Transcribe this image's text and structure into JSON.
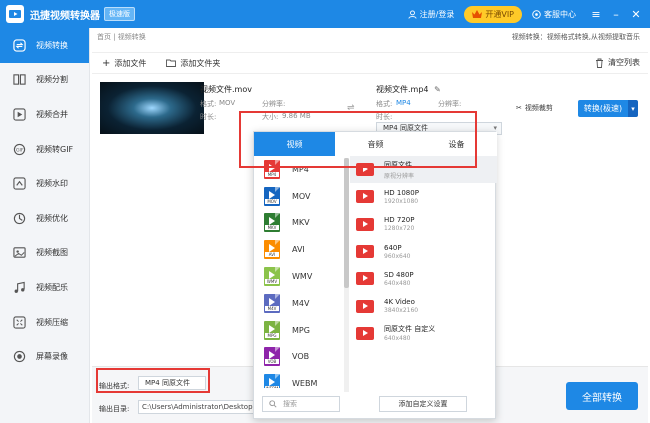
{
  "titlebar": {
    "title": "迅捷视频转换器",
    "badge": "极速版",
    "login": "注册/登录",
    "vip": "开通VIP",
    "service": "客服中心"
  },
  "sidebar": {
    "items": [
      {
        "label": "视频转换",
        "icon": "convert-icon",
        "active": true
      },
      {
        "label": "视频分割",
        "icon": "split-icon"
      },
      {
        "label": "视频合并",
        "icon": "merge-icon"
      },
      {
        "label": "视频转GIF",
        "icon": "gif-icon"
      },
      {
        "label": "视频水印",
        "icon": "watermark-icon"
      },
      {
        "label": "视频优化",
        "icon": "optimize-icon"
      },
      {
        "label": "视频截图",
        "icon": "screenshot-icon"
      },
      {
        "label": "视频配乐",
        "icon": "music-icon"
      },
      {
        "label": "视频压缩",
        "icon": "compress-icon"
      },
      {
        "label": "屏幕录像",
        "icon": "record-icon"
      }
    ]
  },
  "breadcrumb": "首页 | 视频转换",
  "hint": "视频转换：视频格式转换,从视频提取音乐",
  "toolbar": {
    "add_file": "添加文件",
    "add_folder": "添加文件夹",
    "clear": "清空列表"
  },
  "file": {
    "source_name": "视频文件.mov",
    "src_format_label": "格式:",
    "src_format": "MOV",
    "src_res_label": "分辨率:",
    "src_duration_label": "时长:",
    "src_size_label": "大小:",
    "src_size": "9.86 MB",
    "target_name": "视频文件.mp4",
    "dst_format_label": "格式:",
    "dst_format": "MP4",
    "dst_res_label": "分辨率:",
    "dst_duration_label": "时长:",
    "format_select": "MP4  同原文件",
    "clip": "视频裁剪",
    "convert": "转换(极速)"
  },
  "popup": {
    "tabs": [
      "视频",
      "音频",
      "设备"
    ],
    "formats": [
      {
        "name": "MP4",
        "color": "#e53935"
      },
      {
        "name": "MOV",
        "color": "#1565c0"
      },
      {
        "name": "MKV",
        "color": "#2e7d32"
      },
      {
        "name": "AVI",
        "color": "#fb8c00"
      },
      {
        "name": "WMV",
        "color": "#8bc34a"
      },
      {
        "name": "M4V",
        "color": "#5c6bc0"
      },
      {
        "name": "MPG",
        "color": "#7cb342"
      },
      {
        "name": "VOB",
        "color": "#8e24aa"
      },
      {
        "name": "WEBM",
        "color": "#1e88e5"
      }
    ],
    "resolutions": [
      {
        "title": "同原文件",
        "sub": "原视分辨率"
      },
      {
        "title": "HD 1080P",
        "sub": "1920x1080"
      },
      {
        "title": "HD 720P",
        "sub": "1280x720"
      },
      {
        "title": "640P",
        "sub": "960x640"
      },
      {
        "title": "SD 480P",
        "sub": "640x480"
      },
      {
        "title": "4K Video",
        "sub": "3840x2160"
      },
      {
        "title": "同原文件 自定义",
        "sub": "640x480"
      }
    ],
    "search_placeholder": "搜索",
    "custom": "添加自定义设置"
  },
  "bottom": {
    "output_format_label": "输出格式:",
    "output_format_value": "MP4  同原文件",
    "output_dir_label": "输出目录:",
    "output_dir_value": "C:\\Users\\Administrator\\Desktop",
    "convert_all": "全部转换"
  },
  "colors": {
    "accent": "#1e88e5",
    "highlight": "#e53935",
    "vip": "#ffca28"
  }
}
